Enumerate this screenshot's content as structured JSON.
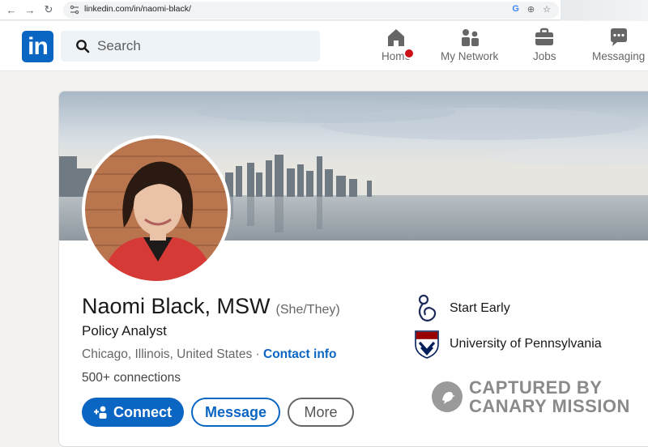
{
  "browser": {
    "url": "linkedin.com/in/naomi-black/",
    "back_icon": "arrow-left-icon",
    "forward_icon": "arrow-right-icon",
    "reload_icon": "reload-icon"
  },
  "header": {
    "logo_text": "in",
    "search_placeholder": "Search",
    "nav": [
      {
        "label": "Home",
        "icon": "home-icon"
      },
      {
        "label": "My Network",
        "icon": "network-icon"
      },
      {
        "label": "Jobs",
        "icon": "briefcase-icon"
      },
      {
        "label": "Messaging",
        "icon": "message-icon"
      }
    ]
  },
  "profile": {
    "name": "Naomi Black, MSW",
    "pronouns": "(She/They)",
    "headline": "Policy Analyst",
    "location": "Chicago, Illinois, United States",
    "separator": "·",
    "contact_info": "Contact info",
    "connections": "500+ connections",
    "buttons": {
      "connect": "Connect",
      "message": "Message",
      "more": "More"
    },
    "experience": [
      {
        "name": "Start Early",
        "icon": "start-early-logo"
      },
      {
        "name": "University of Pennsylvania",
        "icon": "penn-shield-logo"
      }
    ]
  },
  "watermark": {
    "line1": "CAPTURED BY",
    "line2": "CANARY MISSION"
  },
  "colors": {
    "brand": "#0a66c2",
    "background": "#f3f2ef",
    "notification": "#cc1016"
  }
}
